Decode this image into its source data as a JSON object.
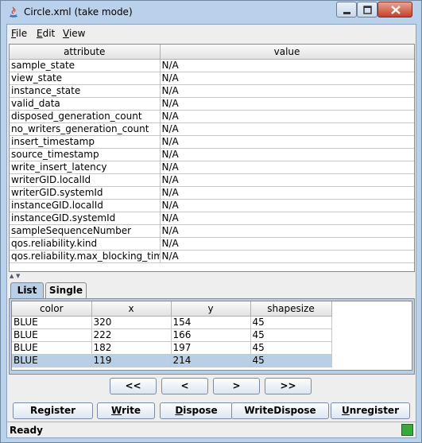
{
  "window": {
    "title": "Circle.xml (take mode)"
  },
  "menu": [
    {
      "mnemonic": "F",
      "rest": "ile"
    },
    {
      "mnemonic": "E",
      "rest": "dit"
    },
    {
      "mnemonic": "V",
      "rest": "iew"
    }
  ],
  "attributes": {
    "headers": [
      "attribute",
      "value"
    ],
    "rows": [
      [
        "sample_state",
        "N/A"
      ],
      [
        "view_state",
        "N/A"
      ],
      [
        "instance_state",
        "N/A"
      ],
      [
        "valid_data",
        "N/A"
      ],
      [
        "disposed_generation_count",
        "N/A"
      ],
      [
        "no_writers_generation_count",
        "N/A"
      ],
      [
        "insert_timestamp",
        "N/A"
      ],
      [
        "source_timestamp",
        "N/A"
      ],
      [
        "write_insert_latency",
        "N/A"
      ],
      [
        "writerGID.localId",
        "N/A"
      ],
      [
        "writerGID.systemId",
        "N/A"
      ],
      [
        "instanceGID.localId",
        "N/A"
      ],
      [
        "instanceGID.systemId",
        "N/A"
      ],
      [
        "sampleSequenceNumber",
        "N/A"
      ],
      [
        "qos.reliability.kind",
        "N/A"
      ],
      [
        "qos.reliability.max_blocking_time",
        "N/A"
      ]
    ]
  },
  "tabs": {
    "list": "List",
    "single": "Single",
    "active": "List"
  },
  "samples": {
    "headers": [
      "color",
      "x",
      "y",
      "shapesize"
    ],
    "rows": [
      [
        "BLUE",
        "320",
        "154",
        "45"
      ],
      [
        "BLUE",
        "222",
        "166",
        "45"
      ],
      [
        "BLUE",
        "182",
        "197",
        "45"
      ],
      [
        "BLUE",
        "119",
        "214",
        "45"
      ]
    ],
    "selected_row": 3
  },
  "nav": {
    "first": "<<",
    "prev": "<",
    "next": ">",
    "last": ">>"
  },
  "actions": {
    "register": "Register",
    "write": {
      "mnemonic": "W",
      "rest": "rite"
    },
    "dispose": {
      "mnemonic": "D",
      "rest": "ispose"
    },
    "writedispose": "WriteDispose",
    "unregister": {
      "mnemonic": "U",
      "rest": "nregister"
    }
  },
  "status": {
    "text": "Ready",
    "indicator_color": "#3aa83a"
  }
}
